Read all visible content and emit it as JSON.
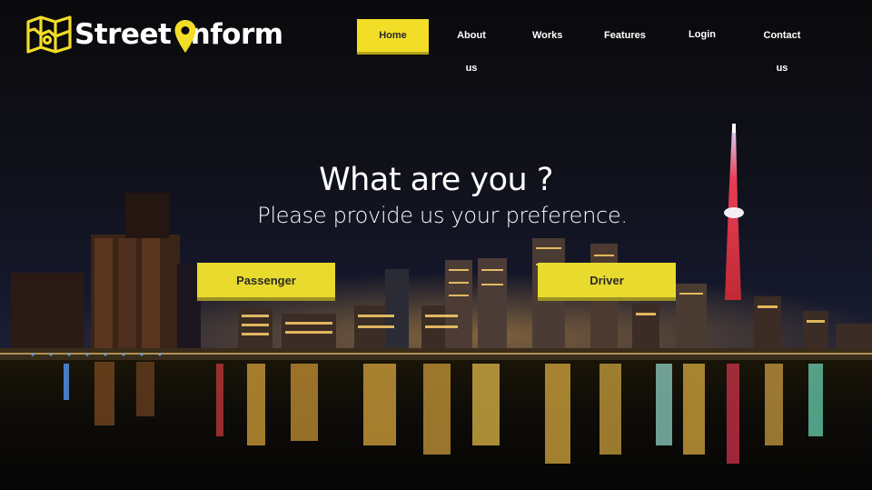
{
  "brand": {
    "name": "Street Inform",
    "accent_color": "#f2dd27",
    "icons": [
      "map-icon",
      "location-pin-icon"
    ]
  },
  "nav": {
    "items": [
      {
        "label": "Home",
        "active": true
      },
      {
        "label": "About us",
        "active": false
      },
      {
        "label": "Works",
        "active": false
      },
      {
        "label": "Features",
        "active": false
      },
      {
        "label": "Login",
        "active": false
      },
      {
        "label": "Contact us",
        "active": false
      }
    ]
  },
  "hero": {
    "title": "What are you ?",
    "subtitle": "Please provide us your preference.",
    "buttons": [
      {
        "label": "Passenger"
      },
      {
        "label": "Driver"
      }
    ]
  }
}
